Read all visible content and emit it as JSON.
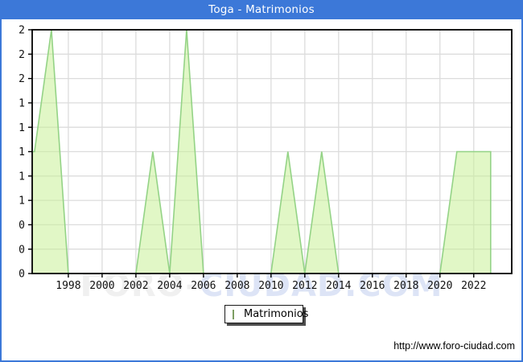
{
  "title": "Toga - Matrimonios",
  "legend": {
    "label": "Matrimonios"
  },
  "footer": {
    "url": "http://www.foro-ciudad.com"
  },
  "watermark": {
    "part1": "FORO-",
    "part2": "CIUDAD.COM"
  },
  "chart_data": {
    "type": "area",
    "title": "Toga - Matrimonios",
    "series": [
      {
        "name": "Matrimonios",
        "x": [
          1996,
          1997,
          1998,
          1999,
          2000,
          2001,
          2002,
          2003,
          2004,
          2005,
          2006,
          2007,
          2008,
          2009,
          2010,
          2011,
          2012,
          2013,
          2014,
          2015,
          2016,
          2017,
          2018,
          2019,
          2020,
          2021,
          2022,
          2023
        ],
        "values": [
          1,
          2,
          0,
          0,
          0,
          0,
          0,
          1,
          0,
          2,
          0,
          0,
          0,
          0,
          0,
          1,
          0,
          1,
          0,
          0,
          0,
          0,
          0,
          0,
          0,
          1,
          1,
          1
        ]
      }
    ],
    "xlim": [
      1995.86,
      2024.25
    ],
    "ylim": [
      0,
      2
    ],
    "x_ticks": [
      1998,
      2000,
      2002,
      2004,
      2006,
      2008,
      2010,
      2012,
      2014,
      2016,
      2018,
      2020,
      2022
    ],
    "y_ticks": [
      {
        "value": 0.0,
        "label": "0"
      },
      {
        "value": 0.2,
        "label": "0"
      },
      {
        "value": 0.4,
        "label": "0"
      },
      {
        "value": 0.6,
        "label": "1"
      },
      {
        "value": 0.8,
        "label": "1"
      },
      {
        "value": 1.0,
        "label": "1"
      },
      {
        "value": 1.2,
        "label": "1"
      },
      {
        "value": 1.4,
        "label": "1"
      },
      {
        "value": 1.6,
        "label": "2"
      },
      {
        "value": 1.8,
        "label": "2"
      },
      {
        "value": 2.0,
        "label": "2"
      }
    ],
    "grid": true,
    "legend_position": "bottom",
    "colors": {
      "area_fill": "rgba(201,240,152,0.55)",
      "area_stroke": "#94d386",
      "grid": "#dcdcdc",
      "plot_border": "#000000",
      "axis_text": "#111111",
      "titlebar": "#3c78d8"
    }
  }
}
